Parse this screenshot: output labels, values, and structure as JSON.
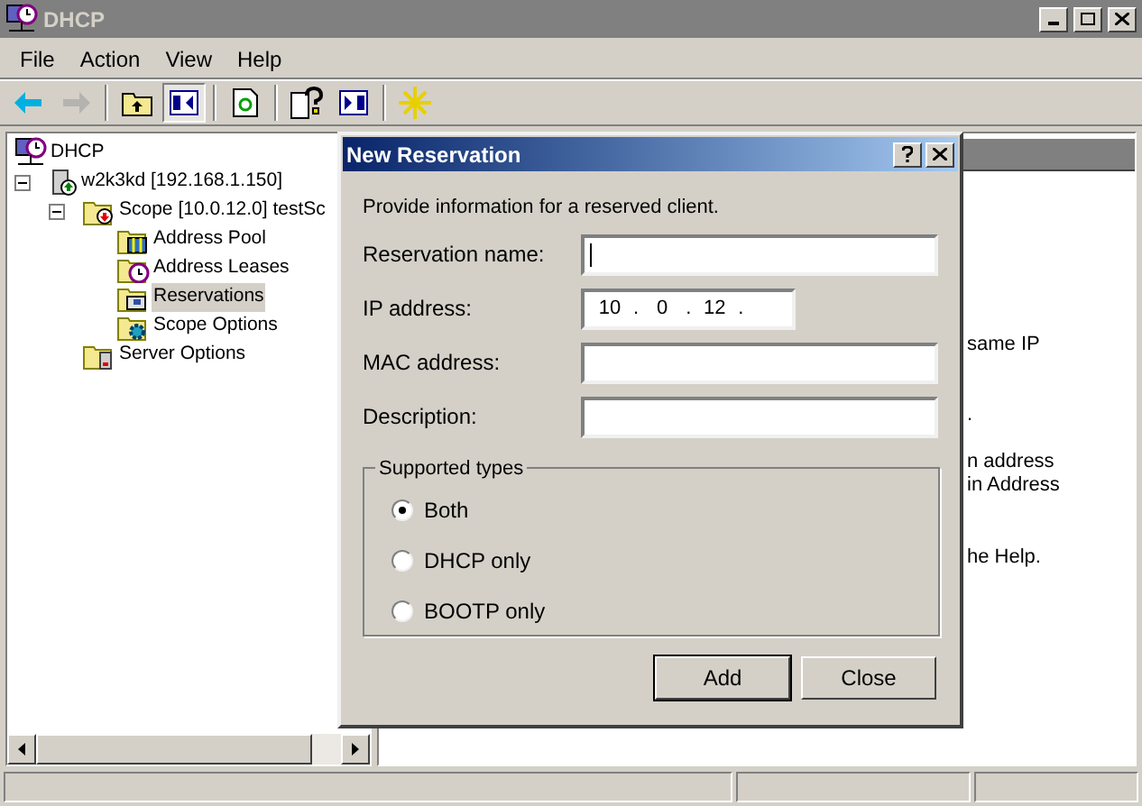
{
  "window": {
    "title": "DHCP",
    "active": false
  },
  "menu": [
    "File",
    "Action",
    "View",
    "Help"
  ],
  "toolbar": [
    [
      {
        "kind": "back",
        "disabled": false,
        "pressed": false
      },
      {
        "kind": "forward",
        "disabled": true,
        "pressed": false
      }
    ],
    [
      {
        "kind": "up",
        "disabled": false,
        "pressed": false
      },
      {
        "kind": "tree",
        "disabled": false,
        "pressed": true
      }
    ],
    [
      {
        "kind": "refresh",
        "disabled": false,
        "pressed": false
      }
    ],
    [
      {
        "kind": "help",
        "disabled": false,
        "pressed": false
      },
      {
        "kind": "pane",
        "disabled": false,
        "pressed": false
      }
    ],
    [
      {
        "kind": "new",
        "disabled": false,
        "pressed": false
      }
    ]
  ],
  "tree": [
    {
      "label": "DHCP",
      "kind": "root",
      "expanded": true,
      "selected": false,
      "children": [
        {
          "label": "w2k3kd [192.168.1.150]",
          "kind": "server",
          "expanded": true,
          "selected": false,
          "children": [
            {
              "label": "Scope [10.0.12.0] testSc",
              "kind": "scope",
              "expanded": true,
              "selected": false,
              "children": [
                {
                  "label": "Address Pool",
                  "kind": "pool",
                  "selected": false
                },
                {
                  "label": "Address Leases",
                  "kind": "leases",
                  "selected": false
                },
                {
                  "label": "Reservations",
                  "kind": "reservations",
                  "selected": true
                },
                {
                  "label": "Scope Options",
                  "kind": "options",
                  "selected": false
                }
              ]
            },
            {
              "label": "Server Options",
              "kind": "server-options",
              "selected": false
            }
          ]
        }
      ]
    }
  ],
  "right_pane": {
    "paragraphs": [
      [
        "same IP"
      ],
      [
        "."
      ],
      [
        "n address",
        "in Address"
      ],
      [
        "he Help."
      ]
    ]
  },
  "dialog": {
    "title": "New Reservation",
    "intro": "Provide information for a reserved client.",
    "fields": [
      {
        "label": "Reservation name:",
        "kind": "text",
        "focused": true
      },
      {
        "label": "IP address:",
        "kind": "ip",
        "parts": [
          "10",
          ".",
          "0",
          ".",
          "12",
          "."
        ]
      },
      {
        "label": "MAC address:",
        "kind": "text",
        "focused": false
      },
      {
        "label": "Description:",
        "kind": "text",
        "focused": false
      }
    ],
    "group": {
      "title": "Supported types",
      "options": [
        {
          "label": "Both",
          "selected": true
        },
        {
          "label": "DHCP only",
          "selected": false
        },
        {
          "label": "BOOTP only",
          "selected": false
        }
      ]
    },
    "buttons": [
      {
        "label": "Add",
        "default": true
      },
      {
        "label": "Close",
        "default": false
      }
    ]
  }
}
